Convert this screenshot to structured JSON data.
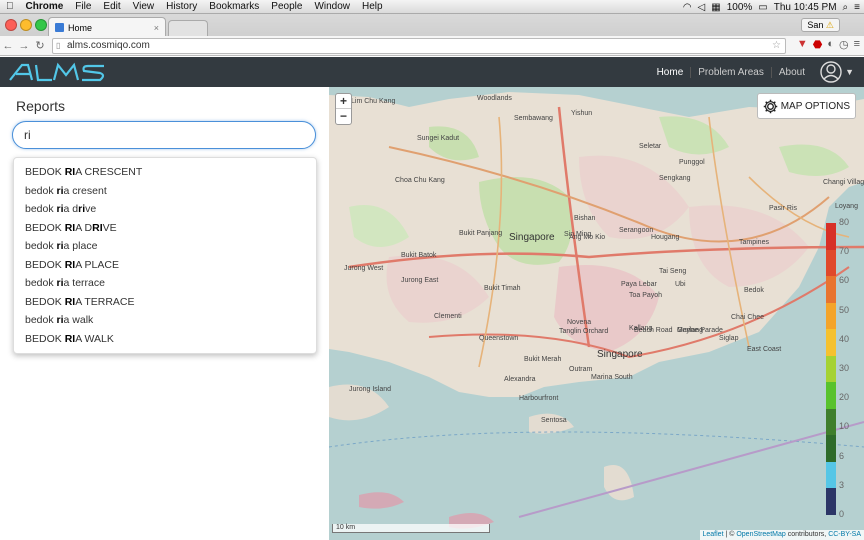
{
  "menubar": {
    "app_name": "Chrome",
    "menus": [
      "File",
      "Edit",
      "View",
      "History",
      "Bookmarks",
      "People",
      "Window",
      "Help"
    ],
    "battery": "100%",
    "clock": "Thu 10:45 PM"
  },
  "browser": {
    "tab_title": "Home",
    "profile_name": "San",
    "url": "alms.cosmiqo.com"
  },
  "nav": {
    "links": [
      "Home",
      "Problem Areas",
      "About"
    ]
  },
  "sidebar": {
    "title": "Reports",
    "search_value": "ri",
    "suggestions": [
      {
        "before": "BEDOK ",
        "match": "RI",
        "after": "A CRESCENT"
      },
      {
        "before": "bedok ",
        "match": "ri",
        "after": "a cresent"
      },
      {
        "before": "bedok ",
        "match": "ri",
        "after": "a drive",
        "extra_match_word": "ri",
        "extra_before": "a d",
        "extra_after": "ve"
      },
      {
        "before": "BEDOK ",
        "match": "RI",
        "after": "A DRIVE",
        "extra_match_word": "RI",
        "extra_before": "A D",
        "extra_after": "VE"
      },
      {
        "before": "bedok ",
        "match": "ri",
        "after": "a place"
      },
      {
        "before": "BEDOK ",
        "match": "RI",
        "after": "A PLACE"
      },
      {
        "before": "bedok ",
        "match": "ri",
        "after": "a terrace"
      },
      {
        "before": "BEDOK ",
        "match": "RI",
        "after": "A TERRACE"
      },
      {
        "before": "bedok ",
        "match": "ri",
        "after": "a walk"
      },
      {
        "before": "BEDOK ",
        "match": "RI",
        "after": "A WALK"
      }
    ]
  },
  "map": {
    "zoom_in": "+",
    "zoom_out": "−",
    "options_label": "MAP OPTIONS",
    "scale_label": "10 km",
    "attribution": {
      "leaflet": "Leaflet",
      "sep": " | © ",
      "osm": "OpenStreetMap",
      "middle": " contributors, ",
      "license": "CC-BY-SA"
    },
    "legend_ticks": [
      "80",
      "70",
      "60",
      "50",
      "40",
      "30",
      "20",
      "10",
      "6",
      "3",
      "0"
    ],
    "legend_colors": [
      "#d73027",
      "#e0492b",
      "#e8742f",
      "#f4a42a",
      "#f6c12e",
      "#a5d233",
      "#58c22c",
      "#3f7e2c",
      "#2e6b2a",
      "#55c6e6",
      "#2b3566"
    ],
    "labels": [
      "Singapore",
      "Singapore",
      "Woodlands",
      "Yishun",
      "Sembawang",
      "Seletar",
      "Choa Chu Kang",
      "Ang Mo Kio",
      "Hougang",
      "Sengkang",
      "Punggol",
      "Serangoon",
      "Bishan",
      "Toa Payoh",
      "Tampines",
      "Pasir Ris",
      "Bedok",
      "Changi Village",
      "Jurong West",
      "Jurong East",
      "Clementi",
      "Queenstown",
      "Novena",
      "Geylang",
      "Marine Parade",
      "East Coast",
      "Bukit Timah",
      "Bukit Batok",
      "Bukit Panjang",
      "Tanglin",
      "Orchard",
      "Outram",
      "Marina South",
      "Harbourfront",
      "Sentosa",
      "Loyang",
      "Tai Seng",
      "Paya Lebar",
      "Bukit Merah",
      "Alexandra",
      "Jurong Island",
      "Lim Chu Kang",
      "Sungei Kadut",
      "Sin Ming",
      "Ubi",
      "Kallang",
      "Beach Road",
      "Chai Chee",
      "Siglap"
    ]
  }
}
